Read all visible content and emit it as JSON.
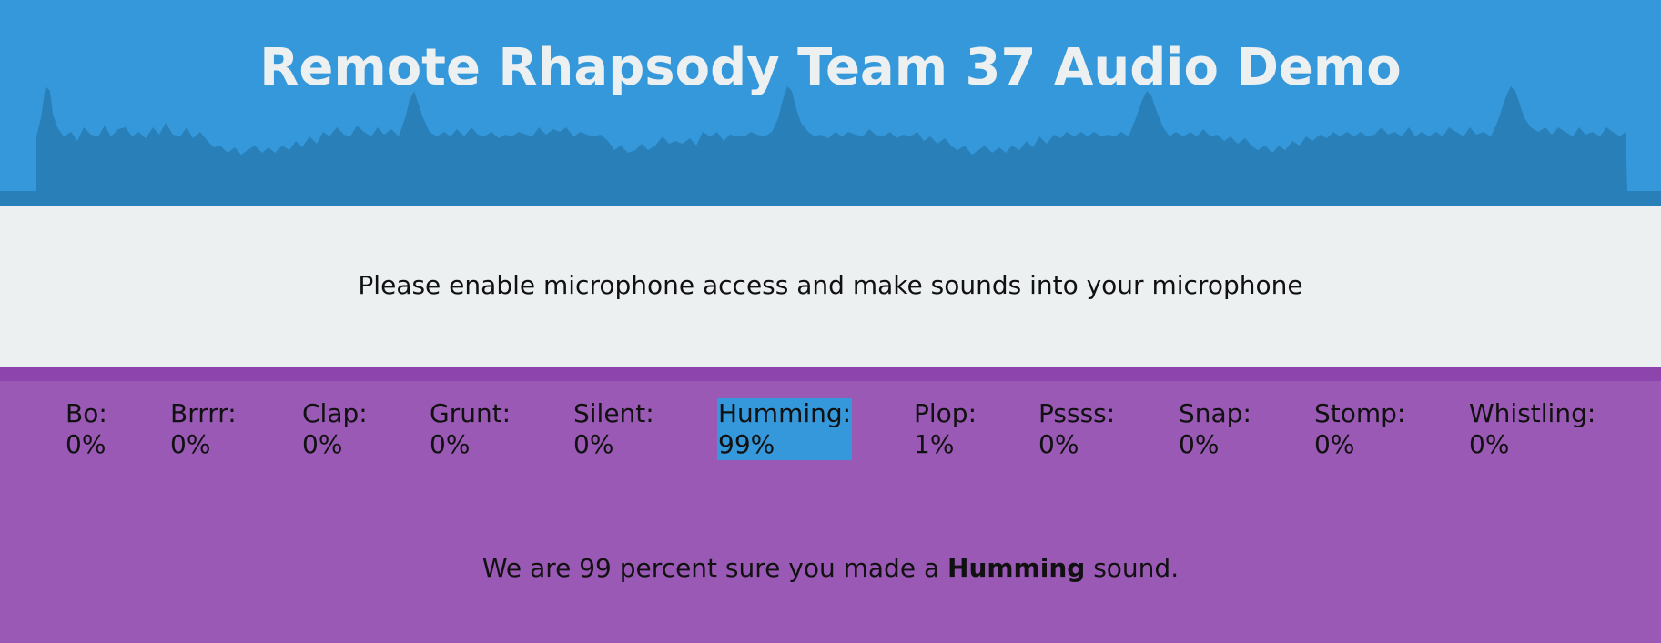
{
  "header": {
    "title": "Remote Rhapsody Team 37 Audio Demo"
  },
  "intro": {
    "message": "Please enable microphone access and make sounds into your microphone"
  },
  "scores": [
    {
      "label": "Bo:",
      "value": "0%",
      "active": false
    },
    {
      "label": "Brrrr:",
      "value": "0%",
      "active": false
    },
    {
      "label": "Clap:",
      "value": "0%",
      "active": false
    },
    {
      "label": "Grunt:",
      "value": "0%",
      "active": false
    },
    {
      "label": "Silent:",
      "value": "0%",
      "active": false
    },
    {
      "label": "Humming:",
      "value": "99%",
      "active": true
    },
    {
      "label": "Plop:",
      "value": "1%",
      "active": false
    },
    {
      "label": "Pssss:",
      "value": "0%",
      "active": false
    },
    {
      "label": "Snap:",
      "value": "0%",
      "active": false
    },
    {
      "label": "Stomp:",
      "value": "0%",
      "active": false
    },
    {
      "label": "Whistling:",
      "value": "0%",
      "active": false
    }
  ],
  "verdict": {
    "prefix": "We are 99 percent sure you made a ",
    "sound": "Humming",
    "suffix": " sound."
  },
  "colors": {
    "header_bg": "#3598db",
    "skyline": "#2980b9",
    "intro_bg": "#ecf0f1",
    "results_bg": "#9b59b6",
    "results_stripe": "#8e44ad",
    "highlight": "#3598db"
  }
}
